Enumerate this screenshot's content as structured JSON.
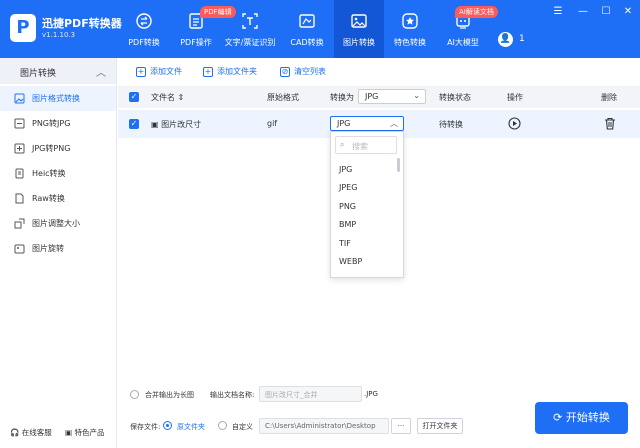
{
  "app": {
    "name": "迅捷PDF转换器",
    "version": "v1.1.10.3",
    "logo_letter": "P"
  },
  "nav": [
    {
      "label": "PDF转换",
      "icon": "pdf-convert-icon"
    },
    {
      "label": "PDF操作",
      "icon": "pdf-edit-icon",
      "tag": "PDF编辑"
    },
    {
      "label": "文字/票证识别",
      "icon": "text-recognition-icon"
    },
    {
      "label": "CAD转换",
      "icon": "cad-icon"
    },
    {
      "label": "图片转换",
      "icon": "image-icon",
      "active": true
    },
    {
      "label": "特色转换",
      "icon": "star-icon"
    },
    {
      "label": "AI大模型",
      "icon": "ai-icon",
      "tag": "AI解读文档"
    }
  ],
  "user": {
    "avatar_glyph": "👤",
    "count": "1"
  },
  "sidebar": {
    "title": "图片转换",
    "items": [
      {
        "label": "图片格式转换",
        "active": true
      },
      {
        "label": "PNG转JPG"
      },
      {
        "label": "JPG转PNG"
      },
      {
        "label": "Heic转换"
      },
      {
        "label": "Raw转换"
      },
      {
        "label": "图片调整大小"
      },
      {
        "label": "图片旋转"
      }
    ],
    "footer": {
      "service": "在线客服",
      "products": "特色产品"
    }
  },
  "toolbar": {
    "add_file": "添加文件",
    "add_folder": "添加文件夹",
    "clear": "清空列表"
  },
  "table": {
    "headers": {
      "name": "文件名",
      "format": "原始格式",
      "convert_to": "转换为",
      "convert_to_value": "JPG",
      "status": "转换状态",
      "action": "操作",
      "delete": "删除"
    },
    "rows": [
      {
        "name": "图片改尺寸",
        "format": "gif",
        "target": "JPG",
        "status": "待转换"
      }
    ]
  },
  "dropdown": {
    "search_placeholder": "搜索",
    "options": [
      "JPG",
      "JPEG",
      "PNG",
      "BMP",
      "TIF",
      "WEBP"
    ]
  },
  "bottom": {
    "merge_label": "合并输出为长图",
    "output_name_label": "输出文档名称:",
    "output_name_placeholder": "图片改尺寸_合并",
    "output_ext": ".JPG",
    "save_label": "保存文件:",
    "original_folder": "原文件夹",
    "custom": "自定义",
    "path": "C:\\Users\\Administrator\\Desktop",
    "more": "···",
    "open_folder": "打开文件夹",
    "start": "开始转换"
  },
  "colors": {
    "accent": "#1e6ff5",
    "tag": "#ff5a5a"
  }
}
